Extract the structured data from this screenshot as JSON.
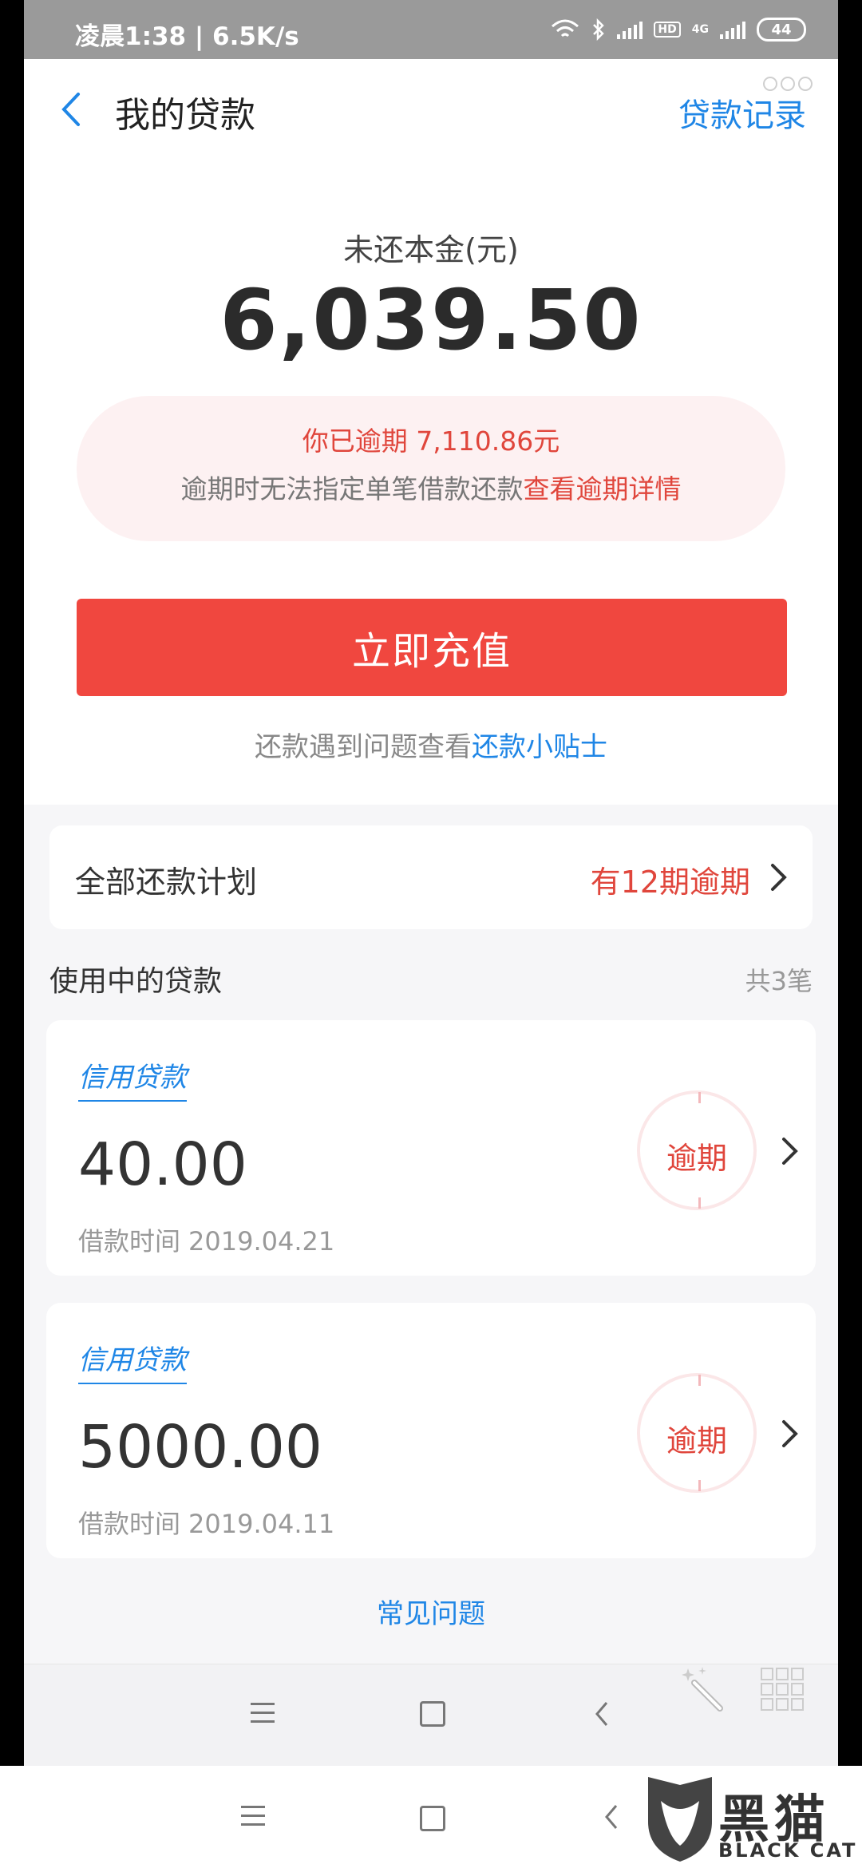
{
  "status_bar": {
    "time_speed": "凌晨1:38 | 6.5K/s",
    "network": "4G",
    "hd": "HD",
    "battery": "44"
  },
  "header": {
    "title": "我的贷款",
    "action": "贷款记录"
  },
  "summary": {
    "principal_label": "未还本金(元)",
    "principal_amount": "6,039.50",
    "overdue_notice": "你已逾期 7,110.86元",
    "overdue_hint": "逾期时无法指定单笔借款还款",
    "overdue_link": "查看逾期详情",
    "recharge_button": "立即充值",
    "tips_text": "还款遇到问题查看",
    "tips_link": "还款小贴士"
  },
  "plan": {
    "label": "全部还款计划",
    "status": "有12期逾期"
  },
  "loans_section": {
    "title": "使用中的贷款",
    "count": "共3笔",
    "items": [
      {
        "type": "信用贷款",
        "amount": "40.00",
        "date_label": "借款时间",
        "date": "2019.04.21",
        "status": "逾期"
      },
      {
        "type": "信用贷款",
        "amount": "5000.00",
        "date_label": "借款时间",
        "date": "2019.04.11",
        "status": "逾期"
      }
    ]
  },
  "faq": "常见问题",
  "watermark": {
    "title": "黑猫",
    "subtitle": "BLACK CAT"
  },
  "colors": {
    "accent_blue": "#1f86e6",
    "alert_red": "#e0463c",
    "button_red": "#f0473f"
  },
  "icons": [
    "back-arrow-icon",
    "chevron-right-icon",
    "magic-wand-icon",
    "keypad-icon",
    "menu-icon",
    "home-icon",
    "back-icon"
  ]
}
